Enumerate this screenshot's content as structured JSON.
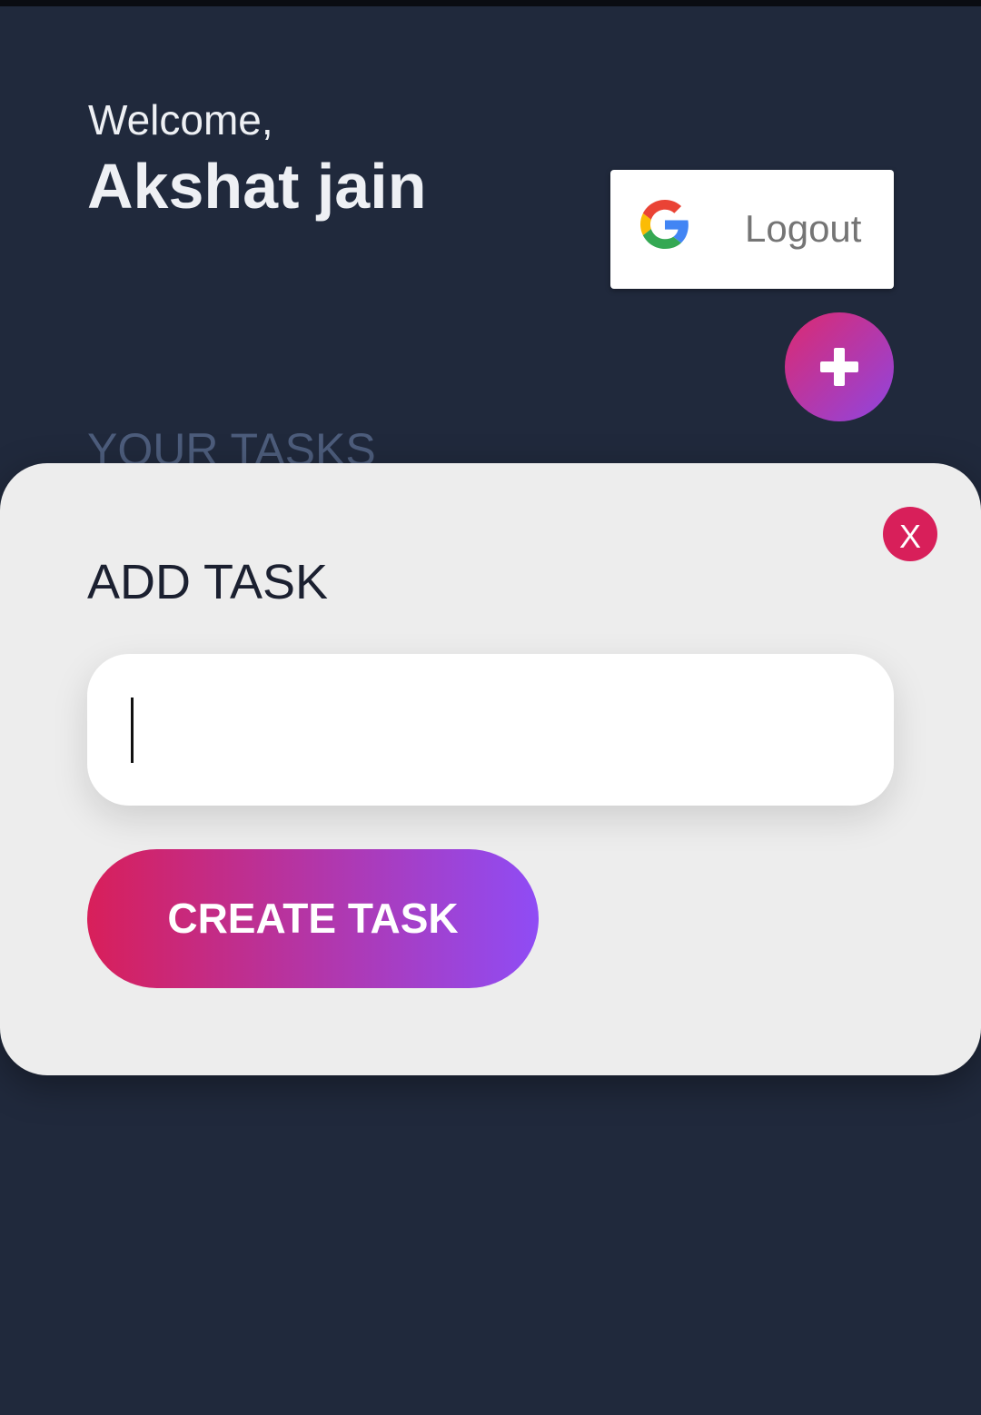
{
  "header": {
    "greeting": "Welcome,",
    "user_name": "Akshat jain"
  },
  "auth": {
    "logout_label": "Logout",
    "provider_icon": "google-g-icon"
  },
  "actions": {
    "add_icon": "plus-icon"
  },
  "tasks_section": {
    "heading": "YOUR TASKS"
  },
  "add_task_modal": {
    "title": "ADD TASK",
    "close_label": "X",
    "input_value": "",
    "input_placeholder": "",
    "create_button_label": "CREATE TASK"
  },
  "colors": {
    "background": "#20293c",
    "modal_background": "#ededed",
    "accent_pink": "#d81f5a",
    "accent_purple": "#8f4cf5",
    "muted_heading": "#4d5d7c",
    "logout_text": "#757575"
  }
}
